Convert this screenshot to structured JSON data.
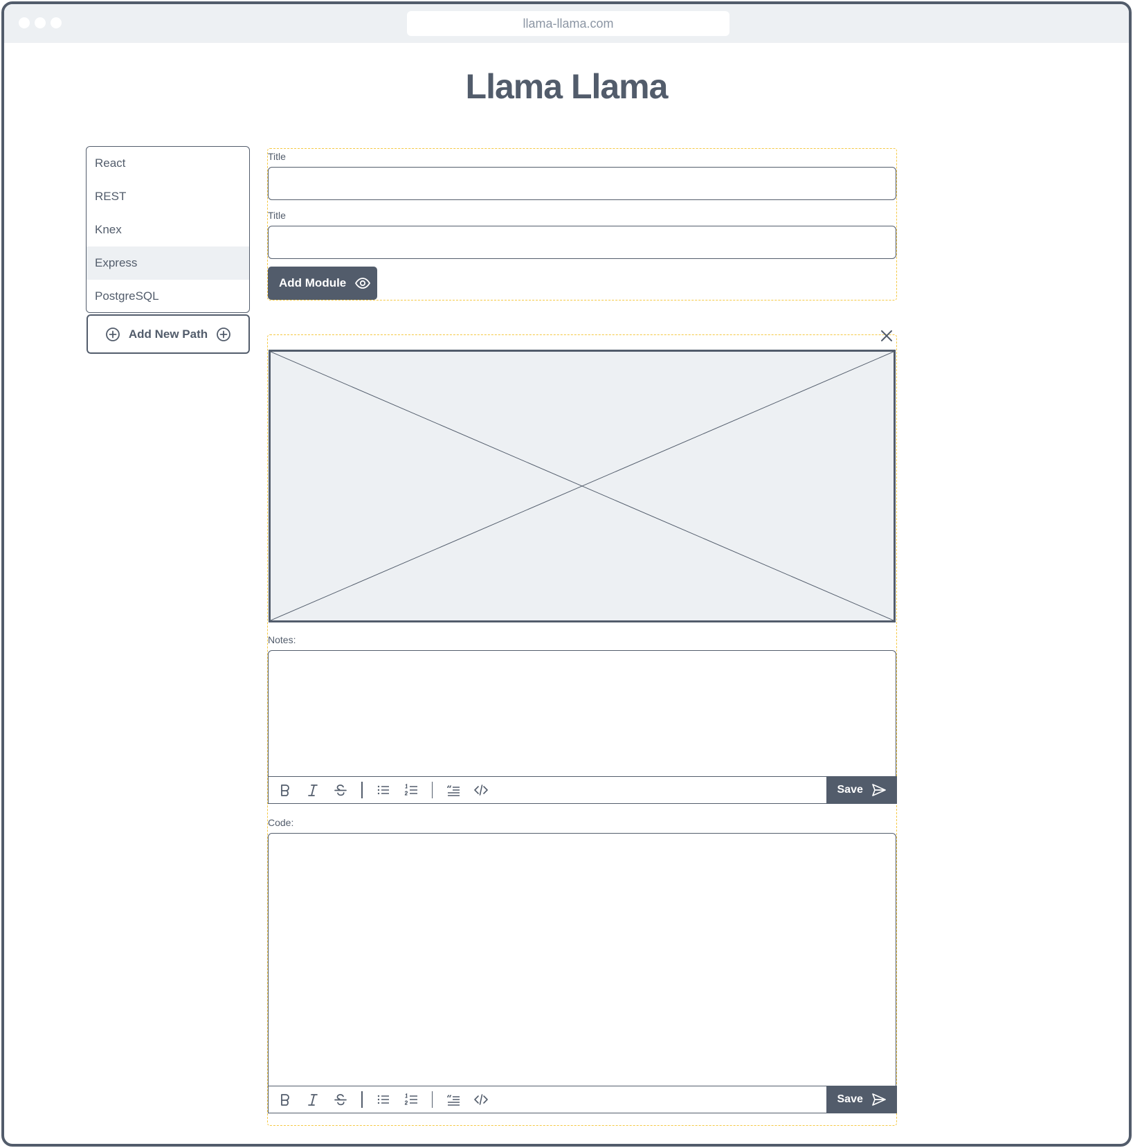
{
  "browser": {
    "url": "llama-llama.com"
  },
  "page": {
    "title": "Llama Llama"
  },
  "sidebar": {
    "items": [
      {
        "label": "React"
      },
      {
        "label": "REST"
      },
      {
        "label": "Knex"
      },
      {
        "label": "Express",
        "active": true
      },
      {
        "label": "PostgreSQL"
      }
    ],
    "add_button_label": "Add New Path"
  },
  "module_form": {
    "field1_label": "Title",
    "field1_value": "",
    "field2_label": "Title",
    "field2_value": "",
    "add_button_label": "Add Module"
  },
  "module_card": {
    "notes_label": "Notes:",
    "notes_value": "",
    "code_label": "Code:",
    "code_value": "",
    "save_label": "Save"
  },
  "toolbar_icons": [
    "bold-icon",
    "italic-icon",
    "strikethrough-icon",
    "bullet-list-icon",
    "numbered-list-icon",
    "quote-icon",
    "code-icon"
  ],
  "colors": {
    "primary": "#525c6b",
    "highlight": "#edf0f3",
    "dashed_border": "#f5c842"
  }
}
